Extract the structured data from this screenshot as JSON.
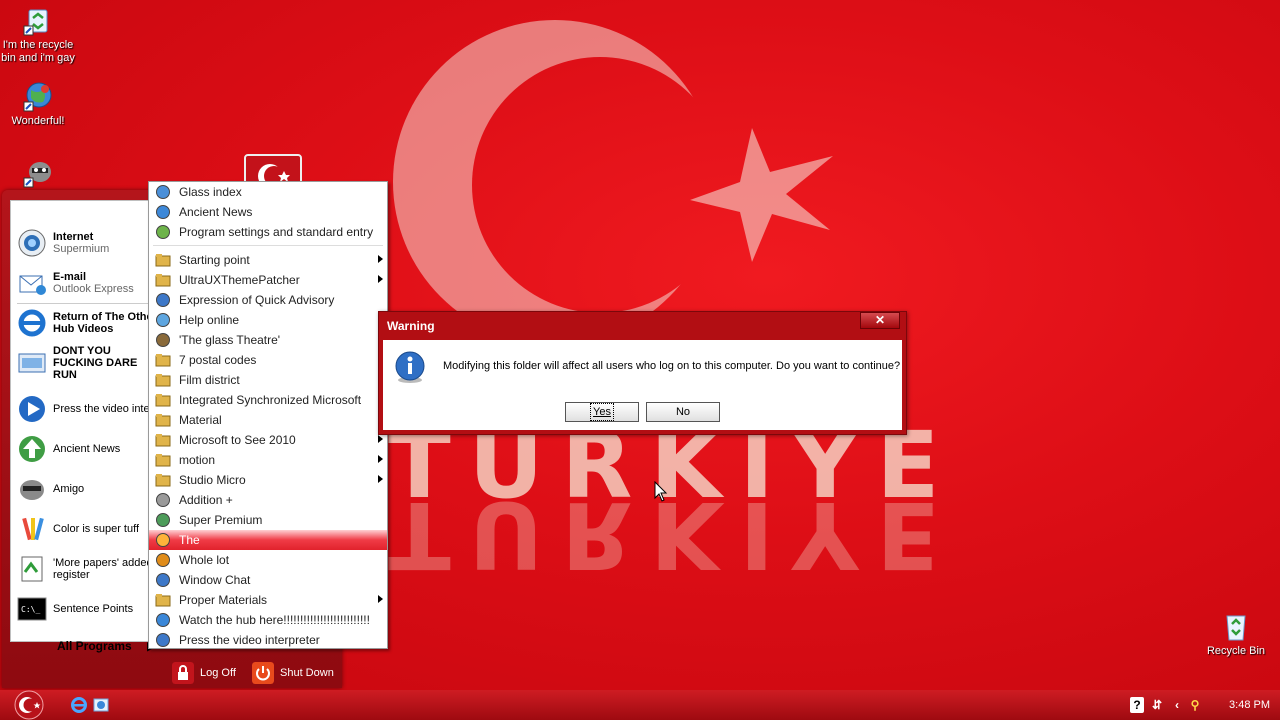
{
  "desktop": {
    "icons": [
      {
        "label": "I'm the recycle bin and i'm gay"
      },
      {
        "label": "Wonderful!"
      },
      {
        "label": ""
      }
    ],
    "recycle_bin_label": "Recycle Bin",
    "wallpaper_text": "TURKIYE"
  },
  "start_menu": {
    "pinned": [
      {
        "title": "Internet",
        "subtitle": "Supermium"
      },
      {
        "title": "E-mail",
        "subtitle": "Outlook Express"
      }
    ],
    "recent": [
      {
        "label": "Return of The Other Hub Videos",
        "bold": true
      },
      {
        "label": "DONT YOU FUCKING DARE RUN",
        "bold": true
      },
      {
        "label": "Press the video interpreter"
      },
      {
        "label": "Ancient News"
      },
      {
        "label": "Amigo"
      },
      {
        "label": "Color is super tuff"
      },
      {
        "label": "'More papers' added register"
      },
      {
        "label": "Sentence Points"
      }
    ],
    "all_programs_label": "All Programs",
    "log_off_label": "Log Off",
    "shut_down_label": "Shut Down"
  },
  "all_programs": {
    "items": [
      {
        "label": "Glass index",
        "submenu": false
      },
      {
        "label": "Ancient News",
        "submenu": false
      },
      {
        "label": "Program settings and standard entry",
        "submenu": false
      },
      {
        "label": "Starting point",
        "submenu": true
      },
      {
        "label": "UltraUXThemePatcher",
        "submenu": true
      },
      {
        "label": "Expression of Quick Advisory",
        "submenu": false
      },
      {
        "label": "Help online",
        "submenu": false
      },
      {
        "label": "'The glass Theatre'",
        "submenu": false
      },
      {
        "label": "7 postal codes",
        "submenu": false
      },
      {
        "label": "Film district",
        "submenu": false
      },
      {
        "label": "Integrated Synchronized Microsoft",
        "submenu": false
      },
      {
        "label": "Material",
        "submenu": false
      },
      {
        "label": "Microsoft to See 2010",
        "submenu": true
      },
      {
        "label": "motion",
        "submenu": true
      },
      {
        "label": "Studio Micro",
        "submenu": true
      },
      {
        "label": "Addition +",
        "submenu": false
      },
      {
        "label": "Super Premium",
        "submenu": false
      },
      {
        "label": "The",
        "submenu": false,
        "selected": true
      },
      {
        "label": "Whole lot",
        "submenu": false
      },
      {
        "label": "Window Chat",
        "submenu": false
      },
      {
        "label": "Proper Materials",
        "submenu": true
      },
      {
        "label": "Watch the hub here!!!!!!!!!!!!!!!!!!!!!!!!!!",
        "submenu": false
      },
      {
        "label": "Press the video interpreter",
        "submenu": false
      }
    ]
  },
  "dialog": {
    "title": "Warning",
    "close_label": "✕",
    "message": "Modifying this folder will affect all users who log on to this computer. Do you want to continue?",
    "yes_label": "Yes",
    "no_label": "No"
  },
  "taskbar": {
    "clock": "3:48 PM"
  },
  "colors": {
    "flag_red": "#d90c14",
    "selection": "#e1222c",
    "dialog_frame": "#b20e13"
  }
}
